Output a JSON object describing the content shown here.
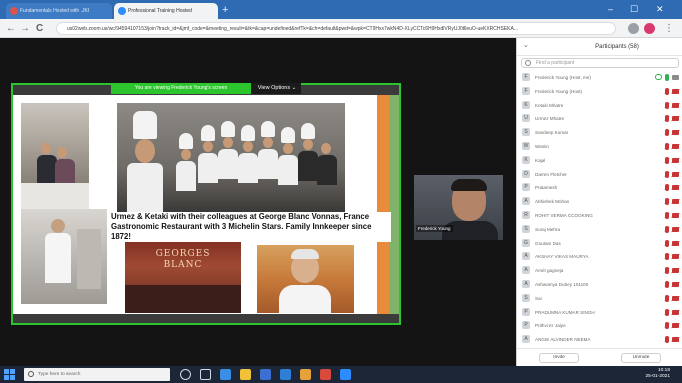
{
  "browser": {
    "tab1_title": "Fundamentals Hosted with .JKI",
    "tab2_title": "Professional Training Hosted",
    "new_tab_glyph": "+",
    "url": "us02web.zoom.us/wc/94594107153/join?track_id=&jmf_code=&meeting_result=&tk=&cap=undefined&refTk=&ch=default&pwd=&wpk=CT9Hxx7wkN4D-XLyCCTc6H9HxdlVRyUJ0tlleuO-ueKXRCHSEKA...",
    "back_glyph": "←",
    "forward_glyph": "→",
    "reload_glyph": "C",
    "window_min": "–",
    "window_max": "☐",
    "window_close": "✕"
  },
  "share": {
    "status": "You are viewing Frederick Young's screen",
    "view_options": "View Options ⌄"
  },
  "slide": {
    "caption_line1": "Urmez & Ketaki with their colleagues at George Blanc Vonnas, France",
    "caption_line2": "Gastronomic Restaurant with 3 Michelin Stars. Family Innkeeper since",
    "caption_line3": "1872!",
    "sign_text": "GEORGES BLANC"
  },
  "speaker": {
    "name": "Frederick Young"
  },
  "participants_panel": {
    "collapse_glyph": "⌄",
    "title": "Participants (58)",
    "search_placeholder": "Find a participant",
    "participants": [
      {
        "name": "Frederick Young (Host, me)",
        "avatar": "F",
        "status": "active"
      },
      {
        "name": "Frederick Young (Host)",
        "avatar": "F",
        "status": "muted"
      },
      {
        "name": "Ketaki Mhatre",
        "avatar": "K",
        "status": "muted"
      },
      {
        "name": "Urmez Mhatre",
        "avatar": "U",
        "status": "muted"
      },
      {
        "name": "Sandeep Kumar",
        "avatar": "S",
        "status": "muted"
      },
      {
        "name": "Wasim",
        "avatar": "W",
        "status": "muted"
      },
      {
        "name": "Kajal",
        "avatar": "K",
        "status": "muted"
      },
      {
        "name": "Darren Fletcher",
        "avatar": "D",
        "status": "muted"
      },
      {
        "name": "Pratamesh",
        "avatar": "P",
        "status": "muted"
      },
      {
        "name": "Abhishek Mohan",
        "avatar": "A",
        "status": "muted"
      },
      {
        "name": "ROHIT VERMA CCOOKING",
        "avatar": "R",
        "status": "muted"
      },
      {
        "name": "Suraj Mehra",
        "avatar": "S",
        "status": "muted"
      },
      {
        "name": "Goutam Das",
        "avatar": "G",
        "status": "muted"
      },
      {
        "name": "AKSHAY VIKAS MAURYA",
        "avatar": "A",
        "status": "muted"
      },
      {
        "name": "Amrit gagneja",
        "avatar": "A",
        "status": "muted"
      },
      {
        "name": "Ashwamya Dubey 101100",
        "avatar": "A",
        "status": "muted"
      },
      {
        "name": "Sai",
        "avatar": "S",
        "status": "muted"
      },
      {
        "name": "PRADUMNA KUMAR SINGH",
        "avatar": "P",
        "status": "muted"
      },
      {
        "name": "Prithvi Kr Jaiye",
        "avatar": "P",
        "status": "muted"
      },
      {
        "name": "ANGIE ALVINDER NEEMA",
        "avatar": "A",
        "status": "muted"
      }
    ],
    "invite_label": "Invite",
    "unmute_label": "Unmute"
  },
  "taskbar": {
    "search_placeholder": "Type here to search",
    "tray_time": "10:18",
    "tray_date": "25-01-2021"
  }
}
